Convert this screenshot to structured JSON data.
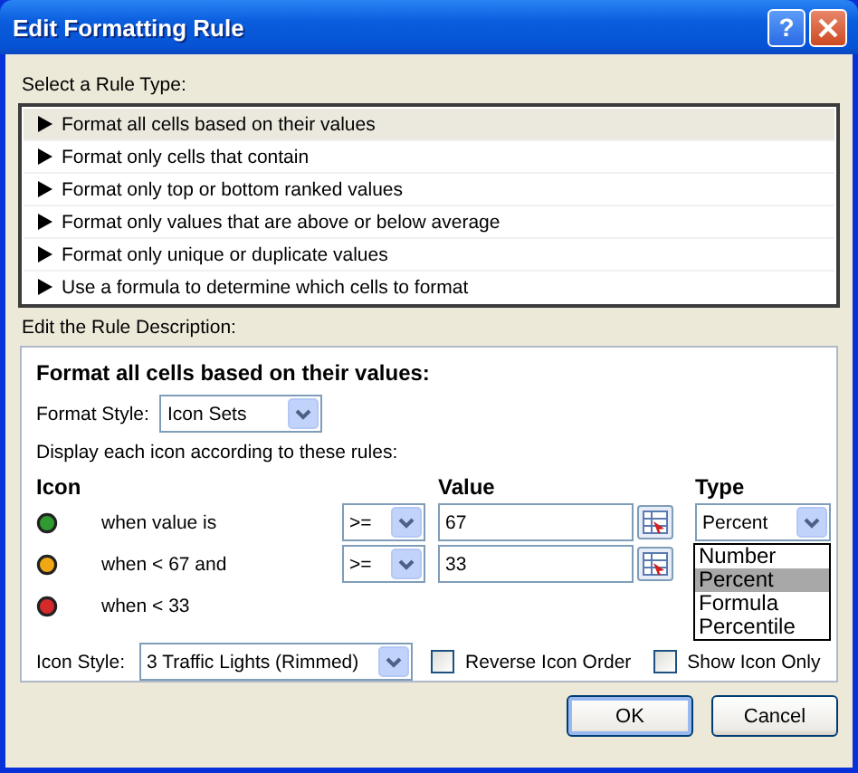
{
  "window": {
    "title": "Edit Formatting Rule",
    "help": "?"
  },
  "rule_type": {
    "label": "Select a Rule Type:",
    "items": [
      {
        "label": "Format all cells based on their values",
        "selected": true
      },
      {
        "label": "Format only cells that contain",
        "selected": false
      },
      {
        "label": "Format only top or bottom ranked values",
        "selected": false
      },
      {
        "label": "Format only values that are above or below average",
        "selected": false
      },
      {
        "label": "Format only unique or duplicate values",
        "selected": false
      },
      {
        "label": "Use a formula to determine which cells to format",
        "selected": false
      }
    ]
  },
  "description": {
    "label": "Edit the Rule Description:",
    "heading": "Format all cells based on their values:",
    "format_style": {
      "label": "Format Style:",
      "value": "Icon Sets"
    },
    "instruction": "Display each icon according to these rules:",
    "columns": [
      "Icon",
      "Value",
      "Type"
    ],
    "rules": [
      {
        "color": "#2f9a2f",
        "condition": "when value is",
        "operator": ">=",
        "value": "67",
        "type": {
          "value": "Percent",
          "expanded": true,
          "options": [
            {
              "label": "Number",
              "selected": false
            },
            {
              "label": "Percent",
              "selected": true
            },
            {
              "label": "Formula",
              "selected": false
            },
            {
              "label": "Percentile",
              "selected": false
            }
          ]
        }
      },
      {
        "color": "#f0a814",
        "condition": "when < 67 and",
        "operator": ">=",
        "value": "33"
      },
      {
        "color": "#d42a2a",
        "condition": "when < 33"
      }
    ],
    "icon_style": {
      "label": "Icon Style:",
      "value": "3 Traffic Lights (Rimmed)"
    },
    "checkboxes": [
      {
        "label": "Reverse Icon Order",
        "checked": false
      },
      {
        "label": "Show Icon Only",
        "checked": false
      }
    ]
  },
  "buttons": [
    {
      "label": "OK",
      "default": true
    },
    {
      "label": "Cancel",
      "default": false
    }
  ]
}
